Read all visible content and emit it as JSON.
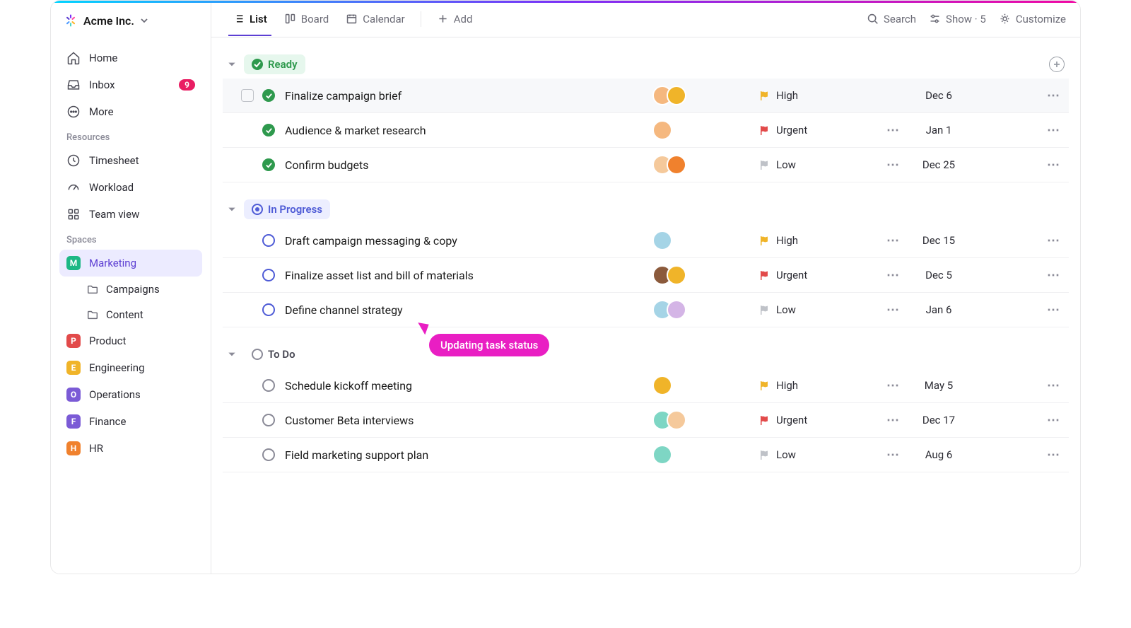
{
  "workspace": {
    "name": "Acme Inc."
  },
  "nav": {
    "home": "Home",
    "inbox": "Inbox",
    "inbox_badge": "9",
    "more": "More"
  },
  "resources": {
    "label": "Resources",
    "timesheet": "Timesheet",
    "workload": "Workload",
    "teamview": "Team view"
  },
  "spaces": {
    "label": "Spaces",
    "items": [
      {
        "letter": "M",
        "name": "Marketing",
        "color": "#1db885",
        "active": true
      },
      {
        "letter": "P",
        "name": "Product",
        "color": "#e24a4a"
      },
      {
        "letter": "E",
        "name": "Engineering",
        "color": "#f0b429"
      },
      {
        "letter": "O",
        "name": "Operations",
        "color": "#7b5bd6"
      },
      {
        "letter": "F",
        "name": "Finance",
        "color": "#7b5bd6"
      },
      {
        "letter": "H",
        "name": "HR",
        "color": "#f0812d"
      }
    ],
    "sub": {
      "campaigns": "Campaigns",
      "content": "Content"
    }
  },
  "views": {
    "list": "List",
    "board": "Board",
    "calendar": "Calendar",
    "add": "Add"
  },
  "topbar": {
    "search": "Search",
    "show": "Show · 5",
    "customize": "Customize"
  },
  "groups": [
    {
      "id": "ready",
      "label": "Ready",
      "chip": "chip-ready",
      "icon": "check",
      "tasks": [
        {
          "name": "Finalize campaign brief",
          "avatars": [
            "#f5b87f",
            "#f0b429"
          ],
          "priority": "High",
          "flag": "#f0b429",
          "date": "Dec 6",
          "extra": false,
          "highlight": true,
          "checkbox": true,
          "status": "done"
        },
        {
          "name": "Audience & market research",
          "avatars": [
            "#f5b87f"
          ],
          "priority": "Urgent",
          "flag": "#e24a4a",
          "date": "Jan 1",
          "extra": true,
          "status": "done"
        },
        {
          "name": "Confirm budgets",
          "avatars": [
            "#f5c99b",
            "#f0812d"
          ],
          "priority": "Low",
          "flag": "#bfc2c8",
          "date": "Dec 25",
          "extra": true,
          "status": "done"
        }
      ]
    },
    {
      "id": "inprogress",
      "label": "In Progress",
      "chip": "chip-progress",
      "icon": "dot",
      "tasks": [
        {
          "name": "Draft campaign messaging & copy",
          "avatars": [
            "#a5d4e6"
          ],
          "priority": "High",
          "flag": "#f0b429",
          "date": "Dec 15",
          "extra": true,
          "status": "prog"
        },
        {
          "name": "Finalize asset list and bill of materials",
          "avatars": [
            "#8b5a3c",
            "#f0b429"
          ],
          "priority": "Urgent",
          "flag": "#e24a4a",
          "date": "Dec 5",
          "extra": true,
          "status": "prog"
        },
        {
          "name": "Define channel strategy",
          "avatars": [
            "#a5d4e6",
            "#d4b5e6"
          ],
          "priority": "Low",
          "flag": "#bfc2c8",
          "date": "Jan 6",
          "extra": true,
          "status": "prog"
        }
      ]
    },
    {
      "id": "todo",
      "label": "To Do",
      "chip": "chip-todo",
      "icon": "ring",
      "tasks": [
        {
          "name": "Schedule kickoff meeting",
          "avatars": [
            "#f0b429"
          ],
          "priority": "High",
          "flag": "#f0b429",
          "date": "May 5",
          "extra": true,
          "status": "todo"
        },
        {
          "name": "Customer Beta interviews",
          "avatars": [
            "#7ed6c4",
            "#f5c99b"
          ],
          "priority": "Urgent",
          "flag": "#e24a4a",
          "date": "Dec 17",
          "extra": true,
          "status": "todo"
        },
        {
          "name": "Field marketing support plan",
          "avatars": [
            "#7ed6c4"
          ],
          "priority": "Low",
          "flag": "#bfc2c8",
          "date": "Aug 6",
          "extra": true,
          "status": "todo"
        }
      ]
    }
  ],
  "cursor_label": "Updating task status"
}
